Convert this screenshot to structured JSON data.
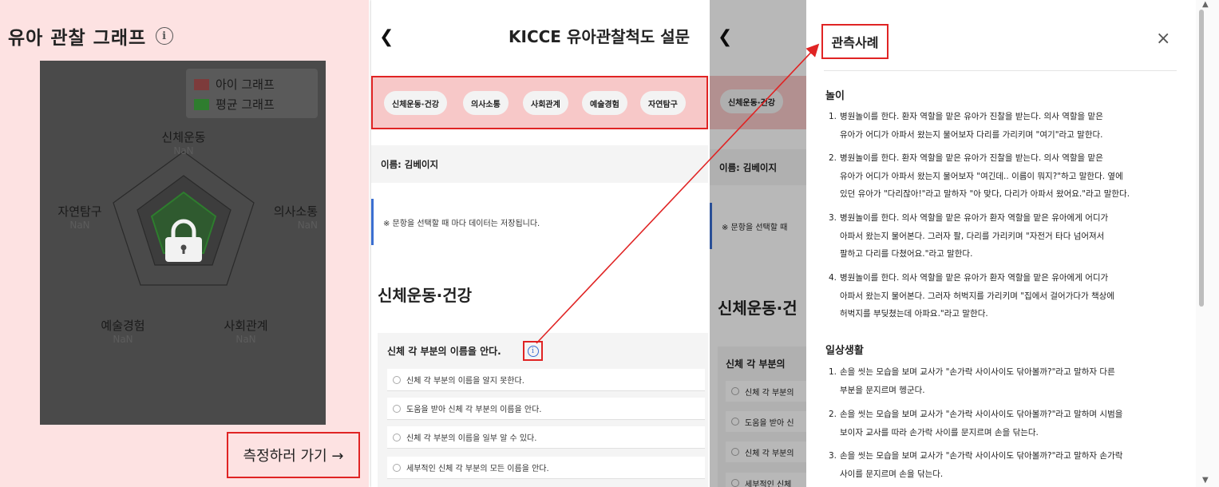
{
  "graph_panel": {
    "title": "유아 관찰 그래프",
    "info_glyph": "i",
    "legend": [
      {
        "label": "아이 그래프",
        "color": "#7d3b3b"
      },
      {
        "label": "평균 그래프",
        "color": "#2e7d2e"
      }
    ],
    "radar_axes": [
      {
        "label": "신체운동",
        "value": "NaN"
      },
      {
        "label": "의사소통",
        "value": "NaN"
      },
      {
        "label": "사회관계",
        "value": "NaN"
      },
      {
        "label": "예술경험",
        "value": "NaN"
      },
      {
        "label": "자연탐구",
        "value": "NaN"
      }
    ],
    "locked_icon": "lock-icon",
    "go_button": "측정하러 가기 →"
  },
  "survey": {
    "back_glyph": "❮",
    "title": "KICCE 유아관찰척도 설문",
    "tabs": [
      "신체운동·건강",
      "의사소통",
      "사회관계",
      "예술경험",
      "자연탐구"
    ],
    "name_label": "이름: 김베이지",
    "notice": "※ 문항을 선택할 때 마다 데이터는 저장됩니다.",
    "section_title": "신체운동·건강",
    "question": "신체 각 부분의 이름을 안다.",
    "info_glyph": "i",
    "options": [
      "신체 각 부분의 이름을 알지 못한다.",
      "도움을 받아 신체 각 부분의 이름을 안다.",
      "신체 각 부분의 이름을 일부 알 수 있다.",
      "세부적인 신체 각 부분의 모든 이름을 안다."
    ]
  },
  "survey_bg": {
    "tab": "신체운동·건강",
    "name_label": "이름: 김베이지",
    "notice": "※ 문항을 선택할 때",
    "section_title": "신체운동·건",
    "question": "신체 각 부분의",
    "options": [
      "신체 각 부분의",
      "도움을 받아 신",
      "신체 각 부분의",
      "세부적인 신체"
    ]
  },
  "modal": {
    "title": "관측사례",
    "close_glyph": "×",
    "categories": [
      {
        "name": "놀이",
        "items": [
          {
            "num": "1.",
            "first": "병원놀이를 한다. 환자 역할을 맡은 유아가 진찰을 받는다. 의사 역할을 맡은",
            "rest": "유아가 어디가 아파서 왔는지 물어보자 다리를 가리키며 \"여기\"라고 말한다."
          },
          {
            "num": "2.",
            "first": "병원놀이를 한다. 환자 역할을 맡은 유아가 진찰을 받는다. 의사 역할을 맡은",
            "rest": "유아가 어디가 아파서 왔는지 물어보자 \"여긴데.. 이름이 뭐지?\"하고 말한다. 옆에",
            "rest2": "있던 유아가 \"다리잖아!\"라고 말하자 \"아 맞다, 다리가 아파서 왔어요.\"라고 말한다."
          },
          {
            "num": "3.",
            "first": "병원놀이를 한다. 의사 역할을 맡은 유아가 환자 역할을 맡은 유아에게 어디가",
            "rest": "아파서 왔는지 물어본다. 그러자 팔, 다리를 가리키며 \"자전거 타다 넘어져서",
            "rest2": "팔하고 다리를 다쳤어요.\"라고 말한다."
          },
          {
            "num": "4.",
            "first": "병원놀이를 한다. 의사 역할을 맡은 유아가 환자 역할을 맡은 유아에게 어디가",
            "rest": "아파서 왔는지 물어본다. 그러자 허벅지를 가리키며 \"집에서 걸어가다가 책상에",
            "rest2": "허벅지를 부딪쳤는데 아파요.\"라고 말한다."
          }
        ]
      },
      {
        "name": "일상생활",
        "items": [
          {
            "num": "1.",
            "first": "손을 씻는 모습을 보며 교사가 \"손가락 사이사이도 닦아볼까?\"라고 말하자 다른",
            "rest": "부분을 문지르며 헹군다."
          },
          {
            "num": "2.",
            "first": "손을 씻는 모습을 보며 교사가 \"손가락 사이사이도 닦아볼까?\"라고 말하며 시범을",
            "rest": "보이자 교사를 따라 손가락 사이를 문지르며 손을 닦는다."
          },
          {
            "num": "3.",
            "first": "손을 씻는 모습을 보며 교사가 \"손가락 사이사이도 닦아볼까?\"라고 말하자 손가락",
            "rest": "사이를 문지르며 손을 닦는다."
          }
        ]
      }
    ]
  },
  "colors": {
    "highlight": "#e02424",
    "accent_blue": "#3b6fd1",
    "graph_bg": "#fde2e2",
    "chart_bg": "#4a4a4a"
  }
}
